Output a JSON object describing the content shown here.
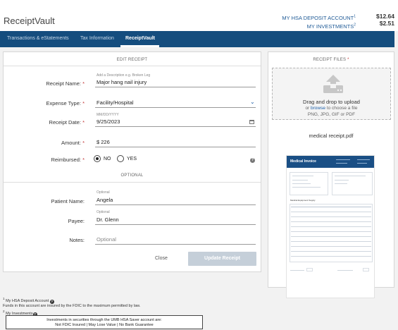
{
  "app": {
    "title": "ReceiptVault"
  },
  "accounts": {
    "hsa_label": "MY HSA DEPOSIT ACCOUNT",
    "hsa_sup": "1",
    "hsa_value": "$12.64",
    "inv_label": "MY INVESTMENTS",
    "inv_sup": "2",
    "inv_value": "$2.51"
  },
  "nav": {
    "items": [
      {
        "label": "Transactions & eStatements"
      },
      {
        "label": "Tax Information"
      },
      {
        "label": "ReceiptVault"
      }
    ],
    "active": "ReceiptVault"
  },
  "edit": {
    "header": "EDIT RECEIPT",
    "required_mark": "*",
    "receipt_name": {
      "label": "Receipt Name:",
      "hint": "Add a Description e.g. Broken Leg",
      "value": "Major hang nail injury"
    },
    "expense_type": {
      "label": "Expense Type:",
      "value": "Facility/Hospital"
    },
    "receipt_date": {
      "label": "Receipt Date:",
      "hint": "MM/DD/YYYY",
      "value": "9/25/2023"
    },
    "amount": {
      "label": "Amount:",
      "value": "$ 226"
    },
    "reimbursed": {
      "label": "Reimbursed:",
      "options": [
        "NO",
        "YES"
      ],
      "selected": "NO",
      "help": "?"
    },
    "optional_header": "OPTIONAL",
    "patient_name": {
      "label": "Patient Name:",
      "hint": "Optional",
      "value": "Angela"
    },
    "payee": {
      "label": "Payee:",
      "hint": "Optional",
      "value": "Dr. Glenn"
    },
    "notes": {
      "label": "Notes:",
      "placeholder": "Optional"
    },
    "close_label": "Close",
    "update_label": "Update Receipt"
  },
  "files": {
    "header": "RECEIPT FILES",
    "required_mark": "*",
    "drop_main": "Drag and drop to upload",
    "drop_or": "or",
    "drop_browse": "browse",
    "drop_rest": "to choose a file",
    "drop_types": "PNG, JPG, GIF or PDF",
    "file_name": "medical receipt.pdf",
    "thumb_title": "Medical Invoice",
    "thumb_section": "Medical Equipment Supply"
  },
  "footnotes": {
    "n1": "1",
    "line1": "My HSA Deposit Account",
    "line2": "Funds in this account are insured by the FDIC to the maximum permitted by law.",
    "n2": "2",
    "line3": "My Investments",
    "box1": "Investments in securities through the UMB HSA Saver account are:",
    "box2": "Not FDIC Insured | May Lose Value | No Bank Guarantee",
    "help": "?"
  },
  "colors": {
    "nav_bg": "#154d7e",
    "accent": "#1c5fa8",
    "required": "#c23434",
    "disabled_button": "#c5cfd9"
  }
}
